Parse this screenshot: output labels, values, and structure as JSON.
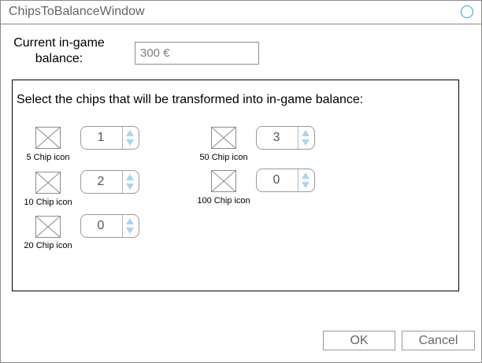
{
  "window": {
    "title": "ChipsToBalanceWindow"
  },
  "balance": {
    "label": "Current in-game balance:",
    "value": "300 €"
  },
  "panel": {
    "heading": "Select the chips that will be transformed into in-game balance:"
  },
  "chips": [
    {
      "icon_caption": "5 Chip icon",
      "quantity": "1"
    },
    {
      "icon_caption": "10 Chip icon",
      "quantity": "2"
    },
    {
      "icon_caption": "20 Chip icon",
      "quantity": "0"
    },
    {
      "icon_caption": "50 Chip icon",
      "quantity": "3"
    },
    {
      "icon_caption": "100 Chip icon",
      "quantity": "0"
    }
  ],
  "buttons": {
    "ok_label": "OK",
    "cancel_label": "Cancel"
  },
  "colors": {
    "spinner_arrow": "#a6d6f5",
    "title_circle": "#2f9ed8"
  }
}
